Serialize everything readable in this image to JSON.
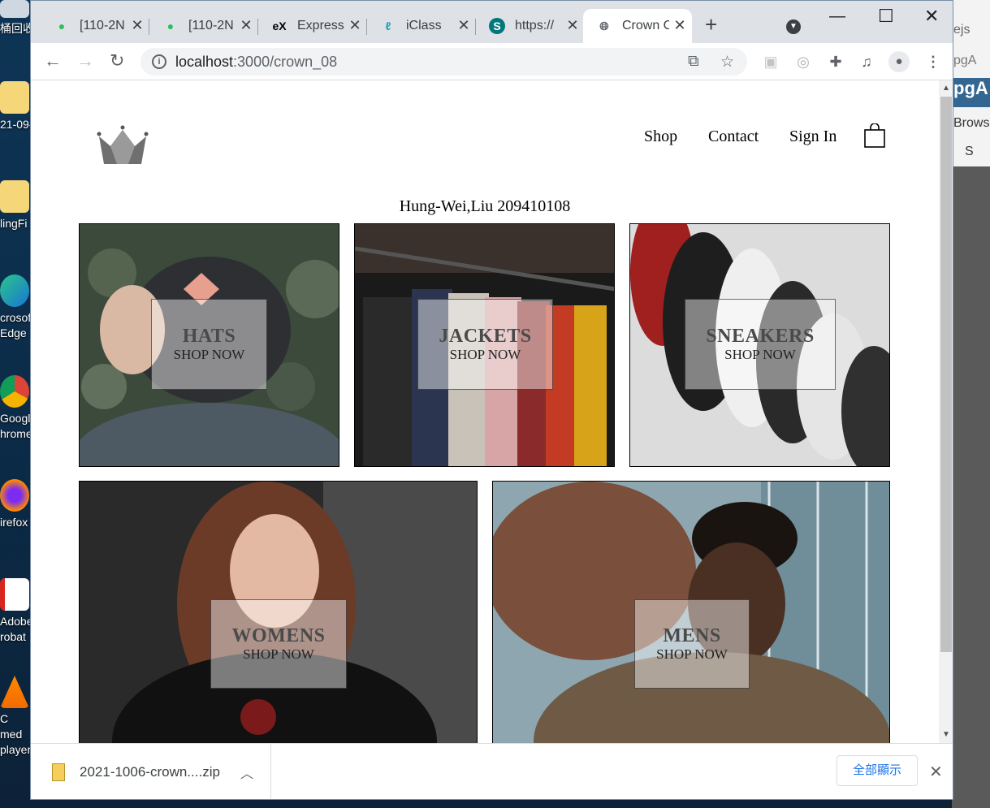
{
  "desktop": {
    "icons": [
      "桶回收",
      "21-09-",
      "lingFi",
      "crosoft Edge",
      "Google hrome",
      "irefox",
      "Adobe robat",
      "C med player"
    ],
    "right_app": {
      "title": "ejs",
      "tab": "pgA",
      "logo": "pgA",
      "browse": "Brows",
      "item": "S"
    }
  },
  "browser": {
    "tabs": [
      {
        "title": "[110-2N",
        "favicon": "evernote-icon"
      },
      {
        "title": "[110-2N",
        "favicon": "evernote-icon"
      },
      {
        "title": "Express",
        "favicon": "express-icon",
        "fav_text": "eX"
      },
      {
        "title": "iClass",
        "favicon": "iclass-icon"
      },
      {
        "title": "https://",
        "favicon": "sharepoint-icon",
        "fav_text": "S"
      },
      {
        "title": "Crown C",
        "favicon": "globe-icon",
        "active": true
      }
    ],
    "url_host": "localhost",
    "url_rest": ":3000/crown_08"
  },
  "page": {
    "nav": {
      "shop": "Shop",
      "contact": "Contact",
      "signin": "Sign In"
    },
    "owner": "Hung-Wei,Liu 209410108",
    "categories": [
      {
        "title": "HATS",
        "subtitle": "SHOP NOW",
        "scene": "hat",
        "colors": [
          "#3c4a3c",
          "#6b7a6a",
          "#2e2f33"
        ]
      },
      {
        "title": "JACKETS",
        "subtitle": "SHOP NOW",
        "scene": "jackets",
        "colors": [
          "#1a1a1a",
          "#7a4a3a",
          "#c9c2b8"
        ]
      },
      {
        "title": "SNEAKERS",
        "subtitle": "SHOP NOW",
        "scene": "sneakers",
        "colors": [
          "#dcdcdc",
          "#1e1e1e",
          "#a02020"
        ]
      },
      {
        "title": "WOMENS",
        "subtitle": "SHOP NOW",
        "scene": "womens",
        "colors": [
          "#2a2a2a",
          "#6b3b28",
          "#111111"
        ]
      },
      {
        "title": "MENS",
        "subtitle": "SHOP NOW",
        "scene": "mens",
        "colors": [
          "#8ea6b0",
          "#2a2320",
          "#6e5a45"
        ]
      }
    ]
  },
  "downloads": {
    "file": "2021-1006-crown....zip",
    "show_all": "全部顯示"
  }
}
